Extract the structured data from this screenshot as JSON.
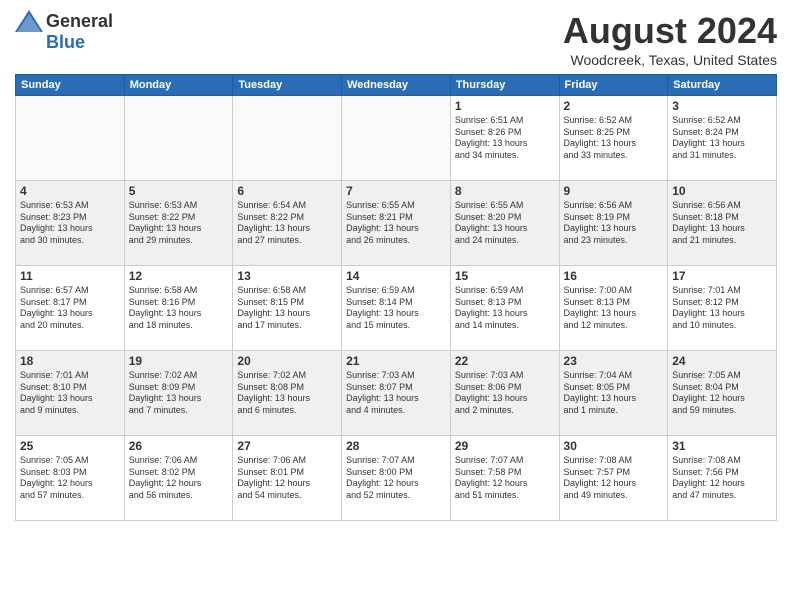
{
  "header": {
    "logo_general": "General",
    "logo_blue": "Blue",
    "month_title": "August 2024",
    "location": "Woodcreek, Texas, United States"
  },
  "days_of_week": [
    "Sunday",
    "Monday",
    "Tuesday",
    "Wednesday",
    "Thursday",
    "Friday",
    "Saturday"
  ],
  "weeks": [
    {
      "alt": false,
      "days": [
        {
          "num": "",
          "info": ""
        },
        {
          "num": "",
          "info": ""
        },
        {
          "num": "",
          "info": ""
        },
        {
          "num": "",
          "info": ""
        },
        {
          "num": "1",
          "info": "Sunrise: 6:51 AM\nSunset: 8:26 PM\nDaylight: 13 hours\nand 34 minutes."
        },
        {
          "num": "2",
          "info": "Sunrise: 6:52 AM\nSunset: 8:25 PM\nDaylight: 13 hours\nand 33 minutes."
        },
        {
          "num": "3",
          "info": "Sunrise: 6:52 AM\nSunset: 8:24 PM\nDaylight: 13 hours\nand 31 minutes."
        }
      ]
    },
    {
      "alt": true,
      "days": [
        {
          "num": "4",
          "info": "Sunrise: 6:53 AM\nSunset: 8:23 PM\nDaylight: 13 hours\nand 30 minutes."
        },
        {
          "num": "5",
          "info": "Sunrise: 6:53 AM\nSunset: 8:22 PM\nDaylight: 13 hours\nand 29 minutes."
        },
        {
          "num": "6",
          "info": "Sunrise: 6:54 AM\nSunset: 8:22 PM\nDaylight: 13 hours\nand 27 minutes."
        },
        {
          "num": "7",
          "info": "Sunrise: 6:55 AM\nSunset: 8:21 PM\nDaylight: 13 hours\nand 26 minutes."
        },
        {
          "num": "8",
          "info": "Sunrise: 6:55 AM\nSunset: 8:20 PM\nDaylight: 13 hours\nand 24 minutes."
        },
        {
          "num": "9",
          "info": "Sunrise: 6:56 AM\nSunset: 8:19 PM\nDaylight: 13 hours\nand 23 minutes."
        },
        {
          "num": "10",
          "info": "Sunrise: 6:56 AM\nSunset: 8:18 PM\nDaylight: 13 hours\nand 21 minutes."
        }
      ]
    },
    {
      "alt": false,
      "days": [
        {
          "num": "11",
          "info": "Sunrise: 6:57 AM\nSunset: 8:17 PM\nDaylight: 13 hours\nand 20 minutes."
        },
        {
          "num": "12",
          "info": "Sunrise: 6:58 AM\nSunset: 8:16 PM\nDaylight: 13 hours\nand 18 minutes."
        },
        {
          "num": "13",
          "info": "Sunrise: 6:58 AM\nSunset: 8:15 PM\nDaylight: 13 hours\nand 17 minutes."
        },
        {
          "num": "14",
          "info": "Sunrise: 6:59 AM\nSunset: 8:14 PM\nDaylight: 13 hours\nand 15 minutes."
        },
        {
          "num": "15",
          "info": "Sunrise: 6:59 AM\nSunset: 8:13 PM\nDaylight: 13 hours\nand 14 minutes."
        },
        {
          "num": "16",
          "info": "Sunrise: 7:00 AM\nSunset: 8:13 PM\nDaylight: 13 hours\nand 12 minutes."
        },
        {
          "num": "17",
          "info": "Sunrise: 7:01 AM\nSunset: 8:12 PM\nDaylight: 13 hours\nand 10 minutes."
        }
      ]
    },
    {
      "alt": true,
      "days": [
        {
          "num": "18",
          "info": "Sunrise: 7:01 AM\nSunset: 8:10 PM\nDaylight: 13 hours\nand 9 minutes."
        },
        {
          "num": "19",
          "info": "Sunrise: 7:02 AM\nSunset: 8:09 PM\nDaylight: 13 hours\nand 7 minutes."
        },
        {
          "num": "20",
          "info": "Sunrise: 7:02 AM\nSunset: 8:08 PM\nDaylight: 13 hours\nand 6 minutes."
        },
        {
          "num": "21",
          "info": "Sunrise: 7:03 AM\nSunset: 8:07 PM\nDaylight: 13 hours\nand 4 minutes."
        },
        {
          "num": "22",
          "info": "Sunrise: 7:03 AM\nSunset: 8:06 PM\nDaylight: 13 hours\nand 2 minutes."
        },
        {
          "num": "23",
          "info": "Sunrise: 7:04 AM\nSunset: 8:05 PM\nDaylight: 13 hours\nand 1 minute."
        },
        {
          "num": "24",
          "info": "Sunrise: 7:05 AM\nSunset: 8:04 PM\nDaylight: 12 hours\nand 59 minutes."
        }
      ]
    },
    {
      "alt": false,
      "days": [
        {
          "num": "25",
          "info": "Sunrise: 7:05 AM\nSunset: 8:03 PM\nDaylight: 12 hours\nand 57 minutes."
        },
        {
          "num": "26",
          "info": "Sunrise: 7:06 AM\nSunset: 8:02 PM\nDaylight: 12 hours\nand 56 minutes."
        },
        {
          "num": "27",
          "info": "Sunrise: 7:06 AM\nSunset: 8:01 PM\nDaylight: 12 hours\nand 54 minutes."
        },
        {
          "num": "28",
          "info": "Sunrise: 7:07 AM\nSunset: 8:00 PM\nDaylight: 12 hours\nand 52 minutes."
        },
        {
          "num": "29",
          "info": "Sunrise: 7:07 AM\nSunset: 7:58 PM\nDaylight: 12 hours\nand 51 minutes."
        },
        {
          "num": "30",
          "info": "Sunrise: 7:08 AM\nSunset: 7:57 PM\nDaylight: 12 hours\nand 49 minutes."
        },
        {
          "num": "31",
          "info": "Sunrise: 7:08 AM\nSunset: 7:56 PM\nDaylight: 12 hours\nand 47 minutes."
        }
      ]
    }
  ]
}
